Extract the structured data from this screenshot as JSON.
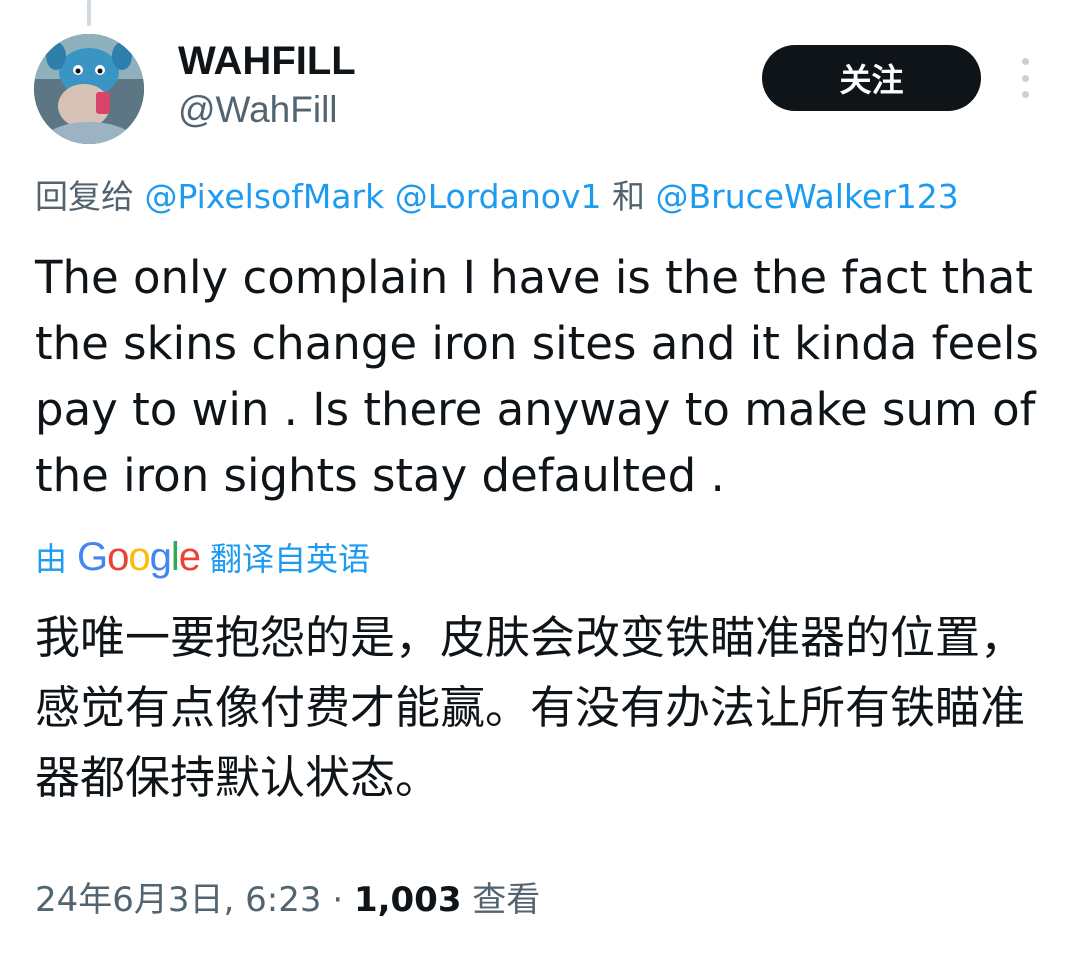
{
  "author": {
    "display_name": "WAHFILL",
    "handle": "@WahFill",
    "avatar_icon": "user-avatar-photo"
  },
  "follow_button": {
    "label": "关注"
  },
  "more_menu": {
    "icon": "more-vertical-icon"
  },
  "reply": {
    "prefix": "回复给",
    "mentions": [
      "@PixelsofMark",
      "@Lordanov1",
      "@BruceWalker123"
    ],
    "conjunction": "和"
  },
  "tweet": {
    "text": "The only complain I have is the the fact that the skins change iron sites and it kinda feels pay to win . Is there anyway to make sum of the iron sights stay defaulted ."
  },
  "translation": {
    "by_label": "由",
    "brand": "Google",
    "suffix": "翻译自英语",
    "text": "我唯一要抱怨的是，皮肤会改变铁瞄准器的位置，感觉有点像付费才能赢。有没有办法让所有铁瞄准器都保持默认状态。"
  },
  "meta": {
    "timestamp": "24年6月3日, 6:23",
    "separator": "·",
    "views_count": "1,003",
    "views_label": "查看"
  },
  "colors": {
    "text_primary": "#0f1419",
    "text_secondary": "#536471",
    "link": "#1d9bf0",
    "button_bg": "#0f1419"
  }
}
